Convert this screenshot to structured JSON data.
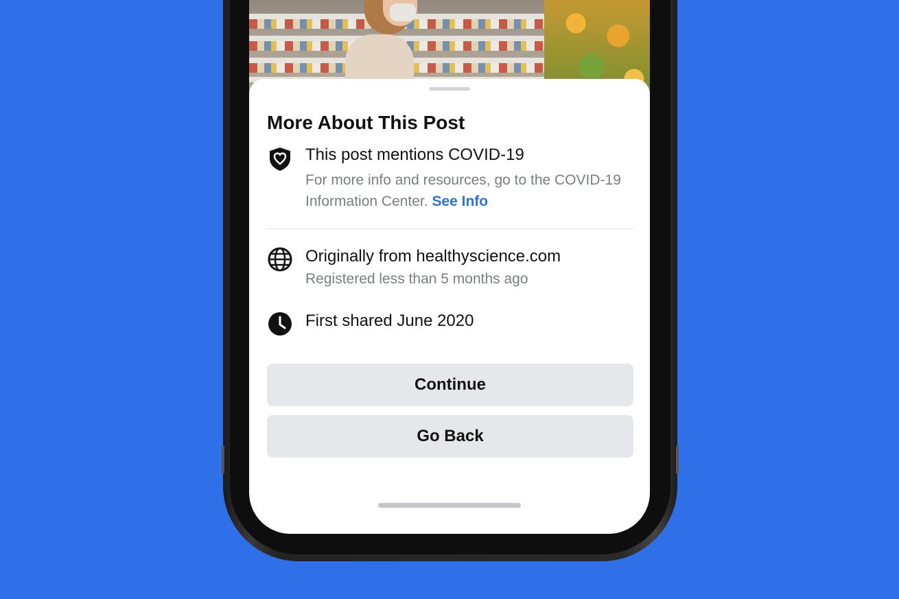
{
  "colors": {
    "background": "#2f6fe8",
    "link": "#2e73d6",
    "button_bg": "#e6e7ea"
  },
  "sheet": {
    "title": "More About This Post",
    "covid": {
      "icon": "heart-shield-icon",
      "title": "This post mentions COVID-19",
      "subtitle": "For more info and resources, go to the COVID-19 Information Center.",
      "link": "See Info"
    },
    "source": {
      "icon": "globe-icon",
      "title": "Originally from healthyscience.com",
      "subtitle": "Registered less than 5 months ago"
    },
    "shared": {
      "icon": "clock-icon",
      "title": "First shared June 2020"
    },
    "buttons": {
      "continue": "Continue",
      "go_back": "Go Back"
    }
  }
}
